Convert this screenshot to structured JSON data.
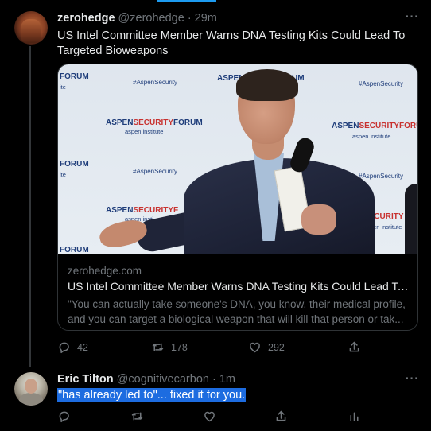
{
  "accent_color": "#1d9bf0",
  "tweet": {
    "author_name": "zerohedge",
    "handle_time": "@zerohedge · 29m",
    "more_label": "···",
    "text": "US Intel Committee Member Warns DNA Testing Kits Could Lead To Targeted Bioweapons",
    "card": {
      "image_wall": {
        "forum_1": "FORUM",
        "forum_2": "FORUM",
        "forum_3": "FORUM",
        "tag_1": "#AspenSecurity",
        "tag_2": "#AspenSecurity",
        "tag_3": "#AspenSecurity",
        "tag_4": "#AspenSecurity",
        "aspen_1": "ASPEN",
        "security_1": "SECURITY",
        "forum_4": "FORUM",
        "institute_1": "aspen institute",
        "aspen_2": "ASPEN",
        "security_2": "SECURITYFORUI",
        "institute_2": "aspen institute",
        "aspen_3": "ASPEN",
        "security_3": "SECURITYF",
        "institute_3": "aspen insti",
        "aspen_top": "ASPEN",
        "um_top": "UM",
        "security_4": "SECURITY FO",
        "institute_4": "aspen institute",
        "ite": "ite"
      },
      "domain": "zerohedge.com",
      "title": "US Intel Committee Member Warns DNA Testing Kits Could Lead To T...",
      "description": "\"You can actually take someone's DNA, you know, their medical profile, and you can target a biological weapon that will kill that person or tak..."
    },
    "actions": {
      "reply_count": "42",
      "retweet_count": "178",
      "like_count": "292"
    }
  },
  "reply": {
    "author_name": "Eric Tilton",
    "handle_time": "@cognitivecarbon · 1m",
    "more_label": "···",
    "text": "\"has already led to\"... fixed it for you."
  }
}
